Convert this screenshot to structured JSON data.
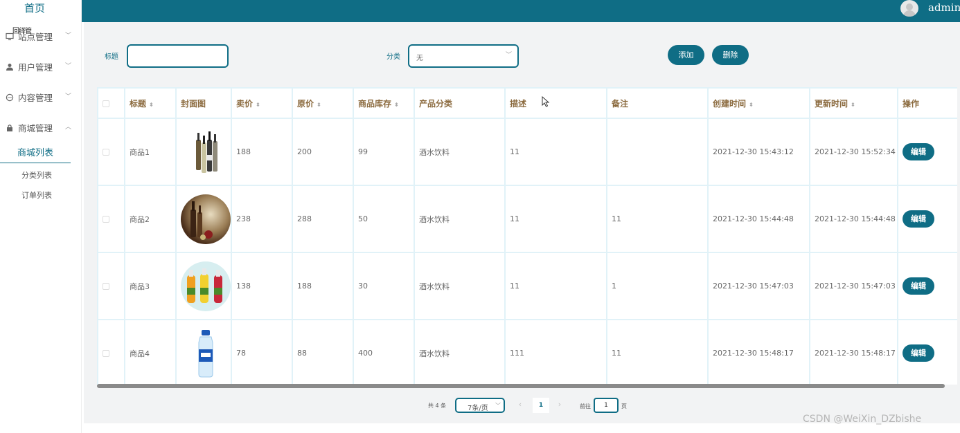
{
  "sidebar": {
    "home": "首页",
    "overlap_text": "回绎管",
    "menus": [
      {
        "label": "站点管理",
        "icon": "monitor-icon",
        "arrow": "﹀"
      },
      {
        "label": "用户管理",
        "icon": "user-icon",
        "arrow": "﹀"
      },
      {
        "label": "内容管理",
        "icon": "chat-icon",
        "arrow": "﹀"
      },
      {
        "label": "商城管理",
        "icon": "shop-icon",
        "arrow": "︿"
      }
    ],
    "submenus": [
      "商城列表",
      "分类列表",
      "订单列表"
    ]
  },
  "header": {
    "username": "admin"
  },
  "filters": {
    "title_label": "标题",
    "title_value": "",
    "category_label": "分类",
    "category_value": "无",
    "add_label": "添加",
    "delete_label": "删除"
  },
  "table": {
    "columns": [
      "标题",
      "封面图",
      "卖价",
      "原价",
      "商品库存",
      "产品分类",
      "描述",
      "备注",
      "创建时间",
      "更新时间",
      "操作"
    ],
    "sort_mark": "⬍",
    "rows": [
      {
        "title": "商品1",
        "cover": "wine-bottles-image",
        "price": "188",
        "original": "200",
        "stock": "99",
        "category": "酒水饮料",
        "desc": "11",
        "note": "",
        "created": "2021-12-30 15:43:12",
        "updated": "2021-12-30 15:52:34",
        "action": "编辑"
      },
      {
        "title": "商品2",
        "cover": "wine-painting-image",
        "price": "238",
        "original": "288",
        "stock": "50",
        "category": "酒水饮料",
        "desc": "11",
        "note": "11",
        "created": "2021-12-30 15:44:48",
        "updated": "2021-12-30 15:44:48",
        "action": "编辑"
      },
      {
        "title": "商品3",
        "cover": "juice-bottles-image",
        "price": "138",
        "original": "188",
        "stock": "30",
        "category": "酒水饮料",
        "desc": "11",
        "note": "1",
        "created": "2021-12-30 15:47:03",
        "updated": "2021-12-30 15:47:03",
        "action": "编辑"
      },
      {
        "title": "商品4",
        "cover": "water-bottle-image",
        "price": "78",
        "original": "88",
        "stock": "400",
        "category": "酒水饮料",
        "desc": "111",
        "note": "11",
        "created": "2021-12-30 15:48:17",
        "updated": "2021-12-30 15:48:17",
        "action": "编辑"
      }
    ]
  },
  "pagination": {
    "total": "共 4 条",
    "page_size": "7条/页",
    "prev": "‹",
    "current": "1",
    "next": "›",
    "goto_label": "前往",
    "goto_value": "1",
    "page_suffix": "页"
  },
  "watermark": "CSDN @WeiXin_DZbishe",
  "colors": {
    "primary": "#0f6d85",
    "header_text": "#8b6a3e"
  }
}
